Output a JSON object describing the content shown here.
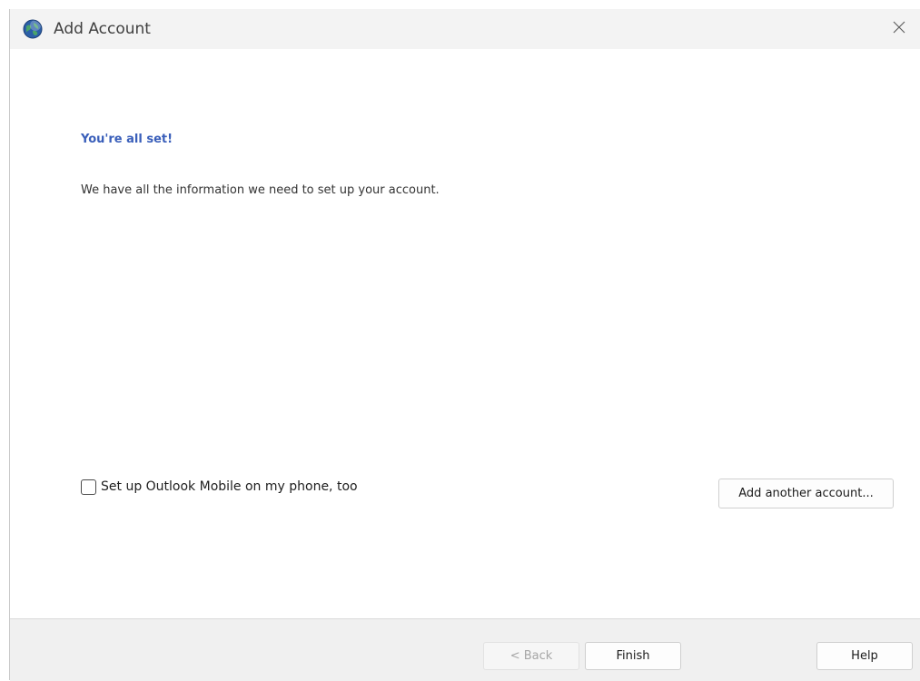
{
  "window": {
    "title": "Add Account",
    "app_icon": "outlook-globe-icon",
    "close_icon": "close-icon"
  },
  "content": {
    "heading": "You're all set!",
    "description": "We have all the information we need to set up your account.",
    "mobile_checkbox": {
      "label": "Set up Outlook Mobile on my phone, too",
      "checked": false
    },
    "add_another_label": "Add another account..."
  },
  "footer": {
    "back_label": "< Back",
    "back_enabled": false,
    "finish_label": "Finish",
    "help_label": "Help"
  },
  "colors": {
    "heading": "#3a5fba",
    "titlebar": "#f3f3f3",
    "footer": "#f0f0f0"
  }
}
